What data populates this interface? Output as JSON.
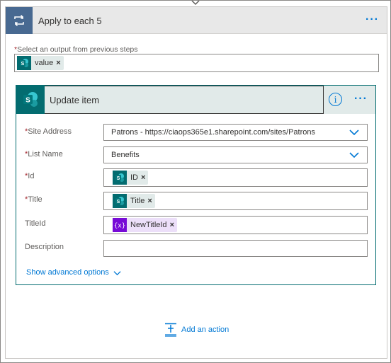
{
  "loop": {
    "title": "Apply to each 5",
    "select_label": "Select an output from previous steps",
    "select_token": "value",
    "more_icon": "more-dots-icon"
  },
  "action": {
    "title": "Update item",
    "info_icon": "info-icon",
    "fields": {
      "site_address": {
        "label": "Site Address",
        "value": "Patrons - https://ciaops365e1.sharepoint.com/sites/Patrons"
      },
      "list_name": {
        "label": "List Name",
        "value": "Benefits"
      },
      "id": {
        "label": "Id",
        "token": "ID"
      },
      "title": {
        "label": "Title",
        "token": "Title"
      },
      "titleid": {
        "label": "TitleId",
        "token": "NewTitleId"
      },
      "description": {
        "label": "Description",
        "value": ""
      }
    },
    "advanced": "Show advanced options"
  },
  "add_action": "Add an action",
  "common": {
    "required_mark": "*",
    "remove_mark": "×"
  },
  "colors": {
    "accent": "#0078d4",
    "sharepoint": "#036c70",
    "variable": "#770bd6",
    "loop": "#486991"
  }
}
